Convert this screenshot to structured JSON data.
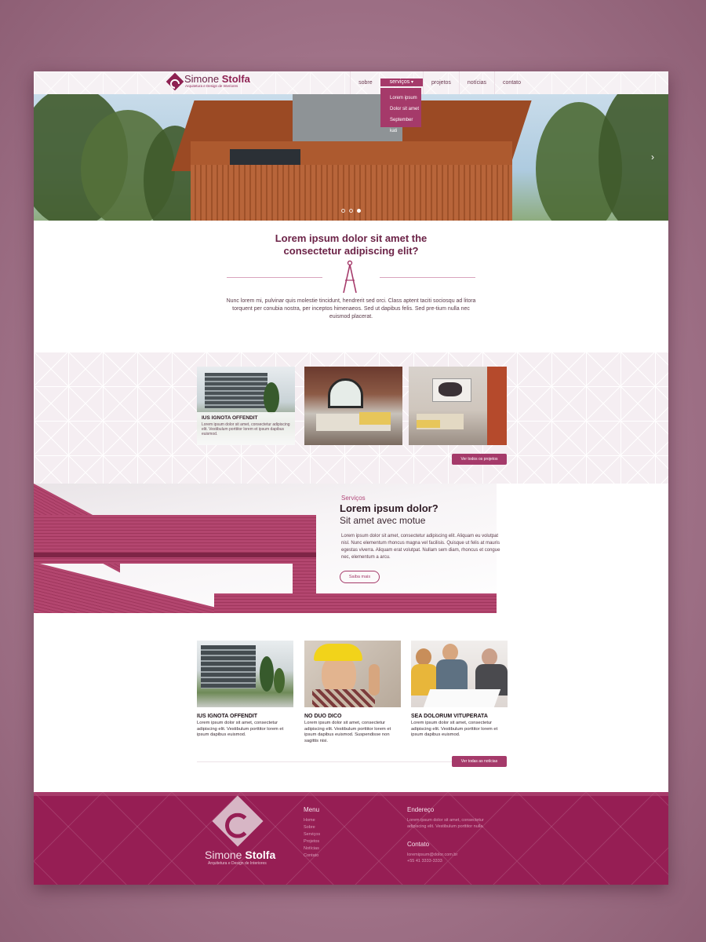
{
  "brand": {
    "name_first": "Simone",
    "name_last": "Stolfa",
    "tagline": "Arquitetura e Design de Interiores"
  },
  "nav": {
    "items": [
      "sobre",
      "serviços",
      "projetos",
      "notícias",
      "contato"
    ],
    "dropdown": [
      "Lorem ipsum",
      "Dolor sit amet",
      "September kati"
    ]
  },
  "intro": {
    "title_line1": "Lorem ipsum dolor sit amet the",
    "title_line2": "consectetur adipiscing elit?",
    "text": "Nunc lorem mi, pulvinar quis molestie tincidunt, hendrerit sed orci. Class aptent taciti sociosqu ad litora torquent per conubia nostra, per inceptos himenaeos. Sed ut dapibus felis. Sed pre-tium nulla nec euismod placerat."
  },
  "projects": {
    "featured_title": "IUS IGNOTA OFFENDIT",
    "featured_text": "Lorem ipsum dolor sit amet, consectetur adipiscing elit. Vestibulum porttitor lorem et ipsum dapibus euismod.",
    "button": "Ver todos os projetos"
  },
  "services": {
    "kicker": "Serviços",
    "title": "Lorem ipsum dolor?",
    "subtitle": "Sit amet avec motue",
    "text": "Lorem ipsum dolor sit amet, consectetur adipiscing elit. Aliquam eu volutpat nisl. Nunc elementum rhoncus magna vel facilisis. Quisque ut felis at mauris egestas viverra. Aliquam erat volutpat. Nullam sem diam, rhoncus et congue nec, elementum a arcu.",
    "button": "Saiba mais"
  },
  "news": {
    "items": [
      {
        "title": "IUS IGNOTA OFFENDIT",
        "text": "Lorem ipsum dolor sit amet, consectetur adipiscing elit. Vestibulum porttitor lorem et ipsum dapibus euismod."
      },
      {
        "title": "NO DUO DICO",
        "text": "Lorem ipsum dolor sit amet, consectetur adipiscing elit. Vestibulum porttitor lorem et ipsum dapibus euismod. Suspendisse non sagittis nisi."
      },
      {
        "title": "SEA DOLORUM VITUPERATA",
        "text": "Lorem ipsum dolor sit amet, consectetur adipiscing elit. Vestibulum porttitor lorem et ipsum dapibus euismod."
      }
    ],
    "button": "Ver todas as notícias"
  },
  "footer": {
    "menu_title": "Menu",
    "menu_items": [
      "Home",
      "Sobre",
      "Serviços",
      "Projetos",
      "Notícias",
      "Contato"
    ],
    "address_title": "Endereço",
    "address_text": "Lorem ipsum dolor sit amet, consectetur adipiscing elit. Vestibulum porttitor nulla.",
    "contact_title": "Contato",
    "email": "loremipsum@dolor.com.br",
    "phone": "+55 41 3333-3333"
  },
  "colors": {
    "accent": "#a53a6a",
    "brand": "#8e2152",
    "footer": "#961e54"
  }
}
